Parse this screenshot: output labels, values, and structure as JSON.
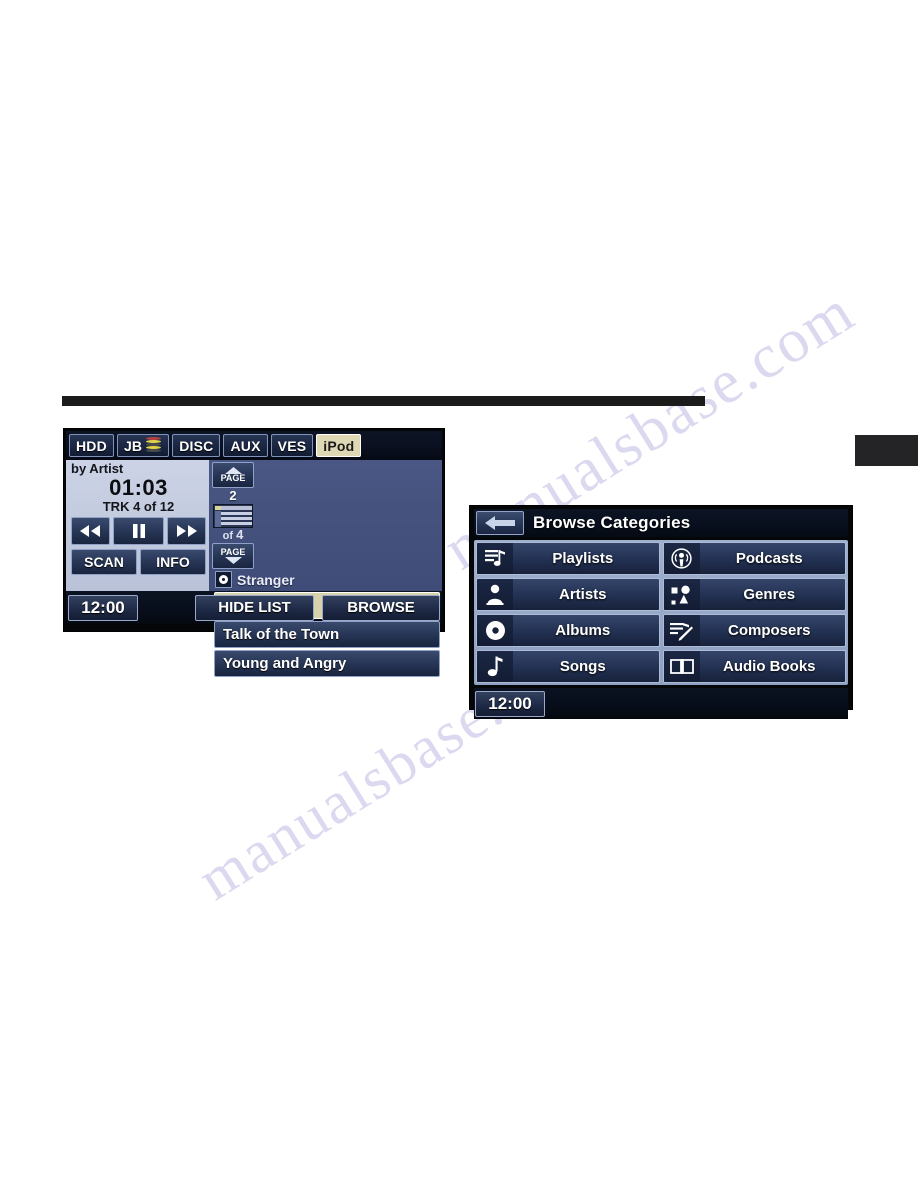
{
  "page": {
    "rule_label": "page-divider",
    "tab_marker_label": "section-tab"
  },
  "watermark": {
    "line1": "manualsbase.com",
    "line2": "manualsbase.com"
  },
  "ipod_screen": {
    "sources": [
      {
        "label": "HDD",
        "icon": "",
        "active": false
      },
      {
        "label": "JB",
        "icon": "jukebox-disc-stack-icon",
        "active": false
      },
      {
        "label": "DISC",
        "icon": "",
        "active": false
      },
      {
        "label": "AUX",
        "icon": "",
        "active": false
      },
      {
        "label": "VES",
        "icon": "",
        "active": false
      },
      {
        "label": "iPod",
        "icon": "",
        "active": true
      }
    ],
    "player": {
      "sort_by": "by Artist",
      "elapsed_time": "01:03",
      "track_status": "TRK 4 of 12",
      "rewind_icon": "rewind-icon",
      "pause_icon": "pause-icon",
      "fast_forward_icon": "fast-forward-icon",
      "scan_label": "SCAN",
      "info_label": "INFO"
    },
    "list": {
      "page_up_label": "PAGE",
      "page_down_label": "PAGE",
      "page_current": "2",
      "page_of_prefix": "of",
      "page_total": "4",
      "now_playing_icon": "disc-icon",
      "now_playing": "Stranger",
      "items": [
        {
          "label": "Stranger",
          "selected": true
        },
        {
          "label": "Talk of the Town",
          "selected": false
        },
        {
          "label": "Young and Angry",
          "selected": false
        }
      ]
    },
    "bottom": {
      "clock": "12:00",
      "hide_list_label": "HIDE LIST",
      "browse_label": "BROWSE"
    }
  },
  "browse_screen": {
    "back_icon": "back-arrow-icon",
    "title": "Browse Categories",
    "categories": [
      {
        "label": "Playlists",
        "icon": "playlist-icon"
      },
      {
        "label": "Podcasts",
        "icon": "podcast-icon"
      },
      {
        "label": "Artists",
        "icon": "artist-person-icon"
      },
      {
        "label": "Genres",
        "icon": "genres-shapes-icon"
      },
      {
        "label": "Albums",
        "icon": "album-disc-icon"
      },
      {
        "label": "Composers",
        "icon": "composer-pen-icon"
      },
      {
        "label": "Songs",
        "icon": "music-note-icon"
      },
      {
        "label": "Audio Books",
        "icon": "open-book-icon"
      }
    ],
    "bottom": {
      "clock": "12:00"
    }
  },
  "colors": {
    "accent_selected": "#d6d2ab",
    "button_blue": "#253453",
    "panel_light": "#c2cade",
    "list_bg": "#47547e"
  }
}
